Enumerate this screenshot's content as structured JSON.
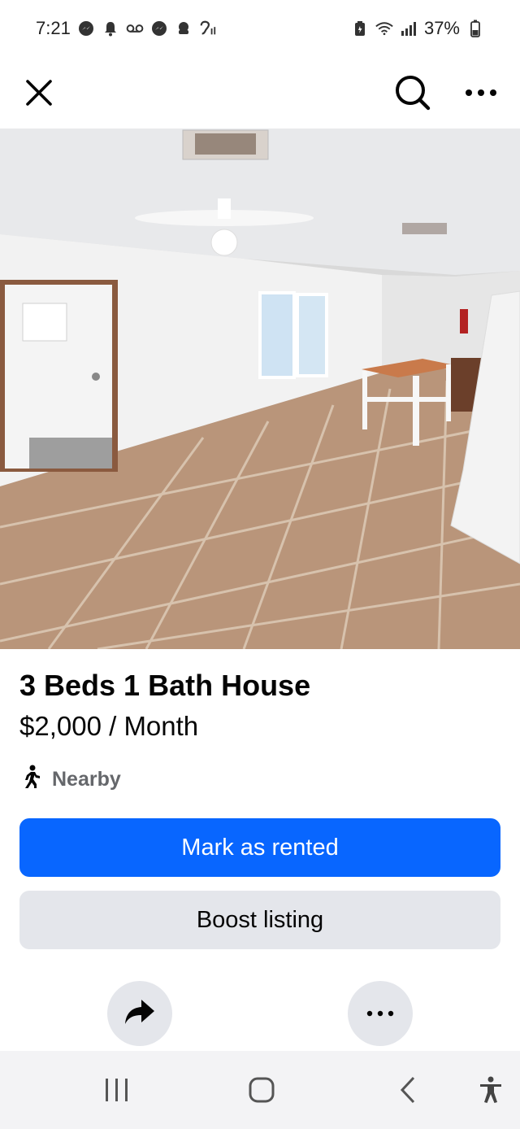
{
  "status_bar": {
    "time": "7:21",
    "battery_percent": "37%",
    "left_icons": [
      "messenger-icon",
      "notification-bell-icon",
      "voicemail-icon",
      "messenger-icon",
      "app-notification-icon",
      "hearing-icon"
    ],
    "right_icons": [
      "battery-saver-icon",
      "wifi-icon",
      "signal-icon",
      "battery-icon"
    ]
  },
  "top_bar": {
    "close_icon": "close-icon",
    "search_icon": "search-icon",
    "more_icon": "more-horizontal-icon"
  },
  "photo": {
    "description_icon": "listing-photo",
    "carousel_count": 7,
    "carousel_active_index": 0
  },
  "listing": {
    "title": "3 Beds 1 Bath House",
    "price": "$2,000 / Month",
    "distance_label": "Nearby"
  },
  "actions": {
    "primary_label": "Mark as rented",
    "secondary_label": "Boost listing",
    "share_icon": "share-icon",
    "more_icon": "more-horizontal-icon"
  },
  "nav_bar": {
    "items": [
      "recents-icon",
      "home-icon",
      "back-icon",
      "accessibility-icon"
    ]
  },
  "colors": {
    "primary_button": "#0866ff",
    "secondary_button": "#e4e6eb",
    "text_secondary": "#65676b"
  }
}
